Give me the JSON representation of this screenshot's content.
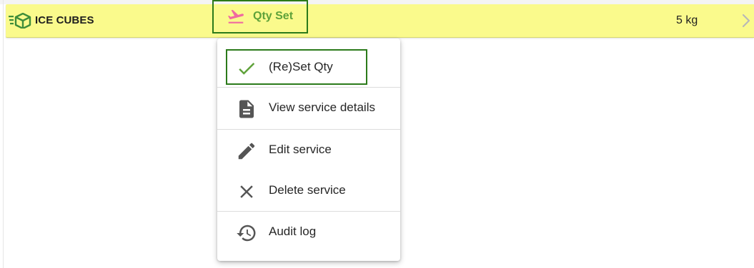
{
  "row": {
    "name": "ICE CUBES",
    "status_label": "Qty Set",
    "quantity": "5 kg",
    "background_color": "#fafa8c",
    "status_color": "#5fa23a",
    "status_icon_color": "#f06aa0",
    "icons": {
      "item": "package-list-icon",
      "status": "flight-takeoff-icon",
      "chevron": "chevron-right-icon"
    }
  },
  "menu": {
    "items": [
      {
        "label": "(Re)Set Qty",
        "icon": "check-icon",
        "icon_color": "#5fa23a"
      },
      {
        "label": "View service details",
        "icon": "document-icon",
        "icon_color": "#555555"
      },
      {
        "label": "Edit service",
        "icon": "pencil-icon",
        "icon_color": "#555555"
      },
      {
        "label": "Delete service",
        "icon": "close-icon",
        "icon_color": "#555555"
      },
      {
        "label": "Audit log",
        "icon": "history-icon",
        "icon_color": "#555555"
      }
    ]
  },
  "highlight_color": "#2b7a1a"
}
